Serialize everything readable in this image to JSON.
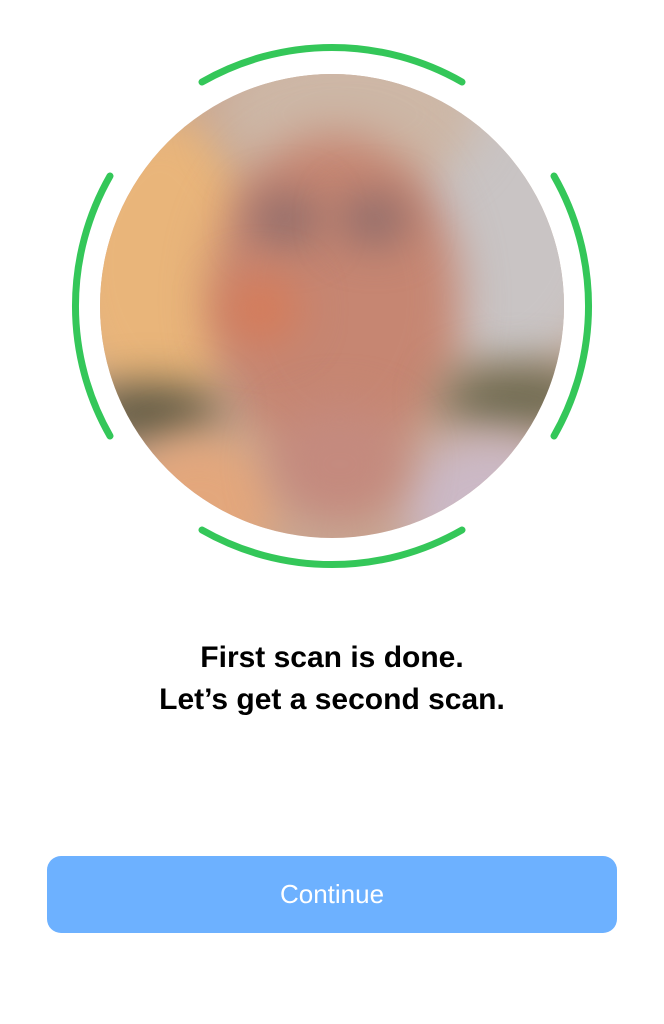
{
  "scan": {
    "status": "complete",
    "ring_color": "#34c759",
    "progress_ring_segments": 4,
    "photo": "blurred-face-preview"
  },
  "message": {
    "line1": "First scan is done.",
    "line2": "Let’s get a second scan."
  },
  "actions": {
    "continue_label": "Continue",
    "continue_color": "#6db1ff"
  }
}
